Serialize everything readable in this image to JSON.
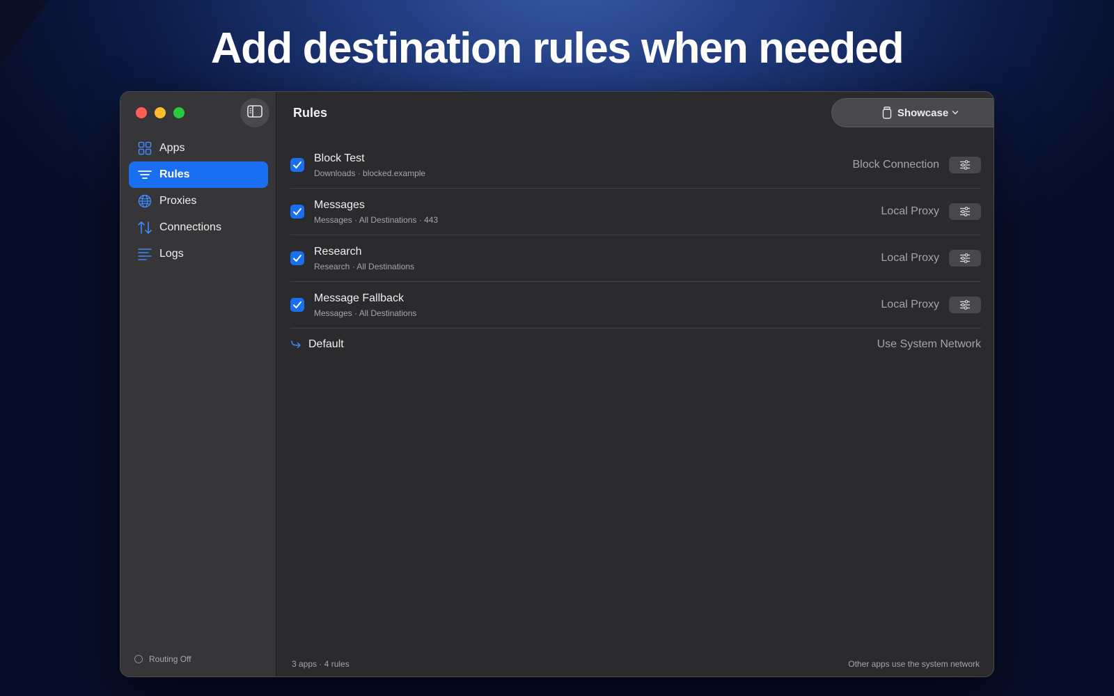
{
  "headline": "Add destination rules when needed",
  "sidebar": {
    "items": [
      {
        "label": "Apps",
        "icon": "grid-icon"
      },
      {
        "label": "Rules",
        "icon": "filter-lines-icon",
        "active": true
      },
      {
        "label": "Proxies",
        "icon": "globe-icon"
      },
      {
        "label": "Connections",
        "icon": "up-down-arrows-icon"
      },
      {
        "label": "Logs",
        "icon": "list-lines-icon"
      }
    ],
    "routing_status": "Routing Off"
  },
  "main": {
    "title": "Rules",
    "profile_label": "Showcase",
    "rules": [
      {
        "name": "Block Test",
        "detail": "Downloads · blocked.example",
        "action": "Block Connection",
        "enabled": true
      },
      {
        "name": "Messages",
        "detail": "Messages · All Destinations · 443",
        "action": "Local Proxy",
        "enabled": true
      },
      {
        "name": "Research",
        "detail": "Research · All Destinations",
        "action": "Local Proxy",
        "enabled": true
      },
      {
        "name": "Message Fallback",
        "detail": "Messages · All Destinations",
        "action": "Local Proxy",
        "enabled": true
      }
    ],
    "default_rule": {
      "label": "Default",
      "action": "Use System Network"
    },
    "status_left": "3 apps · 4 rules",
    "status_right": "Other apps use the system network"
  },
  "colors": {
    "accent": "#1a6ff0",
    "window_bg": "#2b2a2c",
    "sidebar_bg": "#363537"
  }
}
